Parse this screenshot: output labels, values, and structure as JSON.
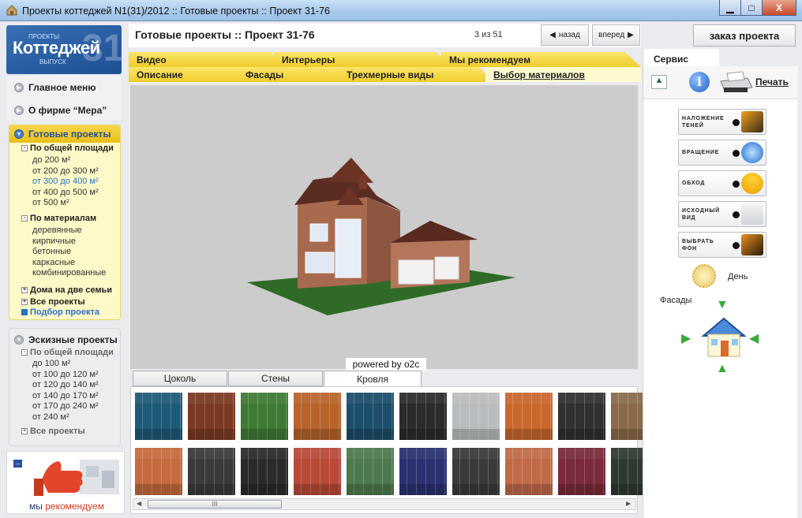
{
  "window": {
    "title": "Проекты коттеджей N1(31)/2012 :: Готовые проекты :: Проект 31-76",
    "minimize": "▁",
    "maximize": "□",
    "close": "X"
  },
  "logo": {
    "line1": "ПРОЕКТЫ",
    "brand": "Коттеджей",
    "issue": "ВЫПУСК",
    "num": "31"
  },
  "nav": {
    "main_menu": "Главное меню",
    "about": "О фирме “Мера”"
  },
  "ready": {
    "title": "Готовые проекты",
    "by_area": "По общей площади",
    "area_items": [
      "до 200 м²",
      "от 200 до 300 м²",
      "от 300 до 400 м²",
      "от 400 до 500 м²",
      "от 500 м²"
    ],
    "by_material": "По материалам",
    "material_items": [
      "деревянные",
      "кирпичные",
      "бетонные",
      "каркасные",
      "комбинированные"
    ],
    "two_family": "Дома на две семьи",
    "all": "Все проекты",
    "select": "Подбор проекта"
  },
  "sketch": {
    "title": "Эскизные проекты",
    "by_area": "По общей площади",
    "area_items": [
      "до 100 м²",
      "от 100 до 120 м²",
      "от 120 до 140 м²",
      "от 140 до 170 м²",
      "от 170 до 240 м²",
      "от  240 м²"
    ],
    "all": "Все проекты"
  },
  "recommend": {
    "prefix": "мы ",
    "word": "рекомендуем"
  },
  "header": {
    "title": "Готовые проекты :: Проект 31-76",
    "counter": "3 из 51",
    "back": "назад",
    "forward": "вперед",
    "order": "заказ проекта"
  },
  "tabs_top": [
    "Видео",
    "Интерьеры",
    "Мы рекомендуем"
  ],
  "tabs_bottom": [
    "Описание",
    "Фасады",
    "Трехмерные виды",
    "Выбор материалов"
  ],
  "viewer": {
    "powered": "powered by o2c"
  },
  "material_tabs": [
    "Цоколь",
    "Стены",
    "Кровля"
  ],
  "service": {
    "tab": "Сервис",
    "print": "Печать",
    "buttons": [
      [
        "НАЛОЖЕНИЕ",
        "ТЕНЕЙ"
      ],
      [
        "ВРАЩЕНИЕ",
        ""
      ],
      [
        "ОБХОД",
        ""
      ],
      [
        "ИСХОДНЫЙ",
        "ВИД"
      ],
      [
        "ВЫБРАТЬ",
        "ФОН"
      ]
    ],
    "day": "День",
    "facades": "Фасады"
  },
  "swatch_colors": {
    "row1": [
      "#1e5a78",
      "#7a3a22",
      "#3f7a34",
      "#b8632a",
      "#1c4d6b",
      "#2b2b2b",
      "#b9bcbe",
      "#c9672c",
      "#303030",
      "#8a6a4a"
    ],
    "row2": [
      "#c46a3c",
      "#3a3a3a",
      "#2a2a2a",
      "#b94a38",
      "#4c7a4e",
      "#2a3070",
      "#3a3a3a",
      "#c06a48",
      "#7a2a3a",
      "#2e3a30"
    ]
  }
}
